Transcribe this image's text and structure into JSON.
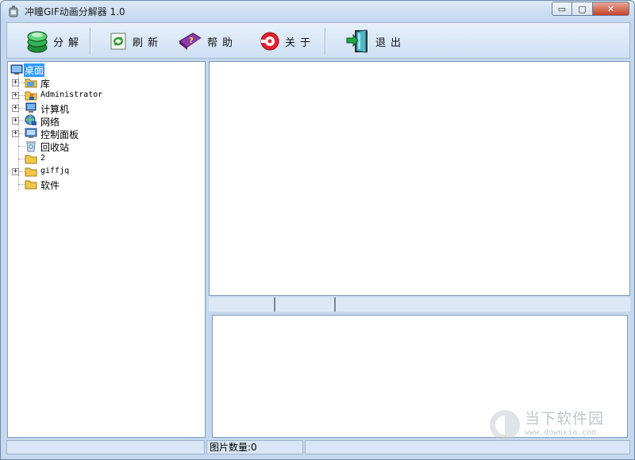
{
  "window": {
    "title": "冲瞳GIF动画分解器 1.0",
    "caption_buttons": {
      "minimize": "▭",
      "maximize": "▢",
      "close": "✕"
    }
  },
  "toolbar": {
    "items": [
      {
        "label": "分解",
        "icon": "layers-icon"
      },
      {
        "label": "刷新",
        "icon": "refresh-icon"
      },
      {
        "label": "帮助",
        "icon": "help-book-icon"
      },
      {
        "label": "关于",
        "icon": "about-disc-icon"
      },
      {
        "label": "退出",
        "icon": "exit-door-icon"
      }
    ]
  },
  "tree": {
    "root": {
      "label": "桌面",
      "icon": "desktop-icon",
      "selected": true
    },
    "items": [
      {
        "label": "库",
        "icon": "library-folder-icon",
        "expandable": true
      },
      {
        "label": "Administrator",
        "icon": "user-folder-icon",
        "expandable": true
      },
      {
        "label": "计算机",
        "icon": "computer-icon",
        "expandable": true
      },
      {
        "label": "网络",
        "icon": "network-icon",
        "expandable": true
      },
      {
        "label": "控制面板",
        "icon": "control-panel-icon",
        "expandable": true
      },
      {
        "label": "回收站",
        "icon": "recycle-bin-icon",
        "expandable": false
      },
      {
        "label": "2",
        "icon": "folder-icon",
        "expandable": false
      },
      {
        "label": "giffjq",
        "icon": "folder-icon",
        "expandable": true
      },
      {
        "label": "软件",
        "icon": "folder-icon",
        "expandable": false
      }
    ],
    "expander_symbol": "+"
  },
  "statusbar": {
    "left": "",
    "frame_count": "图片数量:0",
    "right": ""
  },
  "watermark": {
    "text": "当下软件园",
    "url": "www.downxia.com"
  },
  "colors": {
    "window_frame": "#c5d8ee",
    "selection": "#3399ff",
    "toolbar_bg": "#d9e7f6"
  }
}
